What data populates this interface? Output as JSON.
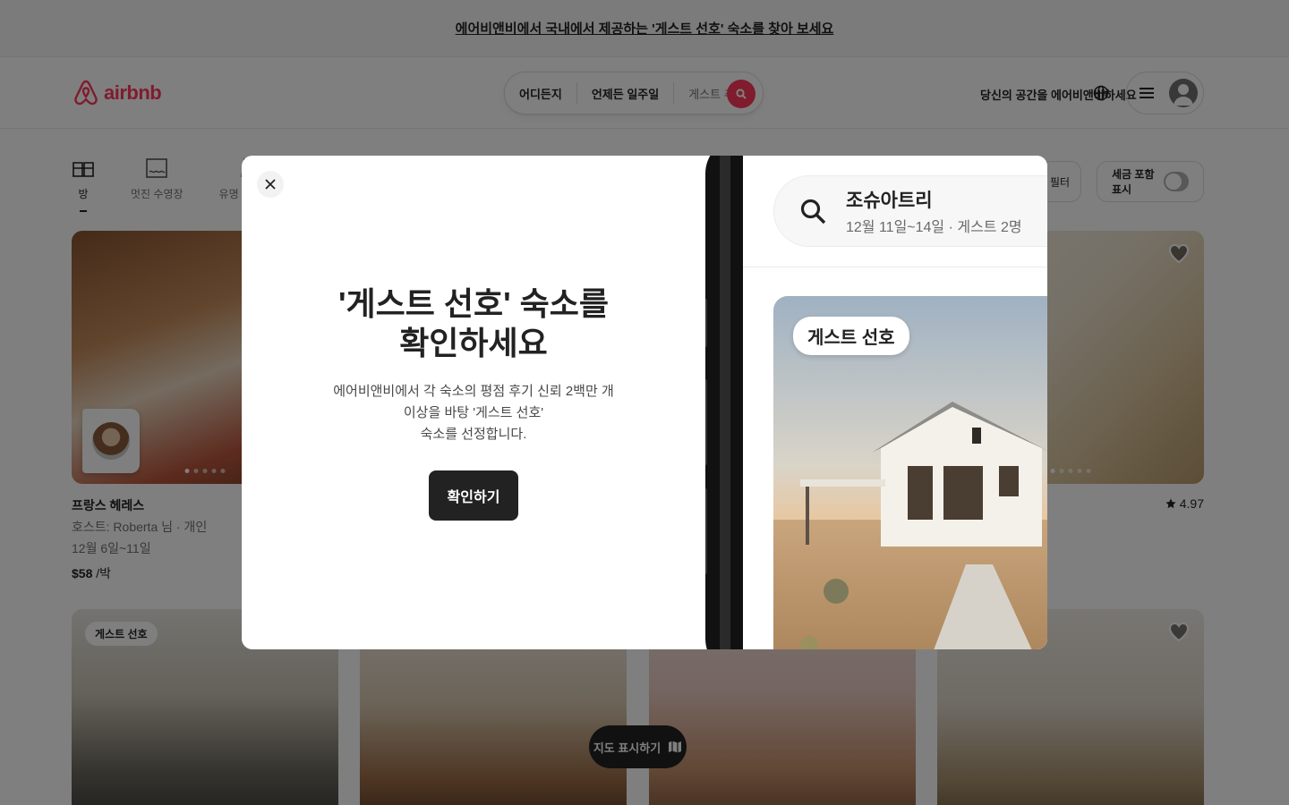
{
  "banner": {
    "text": "에어비앤비에서 국내에서 제공하는 '게스트 선호' 숙소를 찾아 보세요"
  },
  "header": {
    "logo_text": "airbnb",
    "search": {
      "where": "어디든지",
      "when": "언제든 일주일",
      "guests": "게스트 추가"
    },
    "host_link": "당신의 공간을 에어비앤비하세요"
  },
  "categories": [
    {
      "label": "방",
      "icon": "room-icon",
      "active": true
    },
    {
      "label": "멋진 수영장",
      "icon": "pool-icon",
      "active": false
    },
    {
      "label": "유명 관광지",
      "icon": "landmark-icon",
      "active": false
    }
  ],
  "filters": {
    "filter_label": "필터",
    "tax_label": "세금 포함 표시"
  },
  "listings": [
    {
      "title": "프랑스 헤레스",
      "host": "호스트: Roberta 님 · 개인",
      "dates": "12월 6일~11일",
      "price": "$58",
      "per": "/박"
    },
    {
      "rating": "4.97"
    }
  ],
  "listings_row2": [
    {
      "badge": "게스트 선호"
    }
  ],
  "map_button": {
    "label": "지도 표시하기"
  },
  "modal": {
    "title_line1": "'게스트 선호' 숙소를",
    "title_line2": "확인하세요",
    "body_line1": "에어비앤비에서 각 숙소의 평점 후기 신뢰 2백만 개 이상을 바탕 '게스트 선호'",
    "body_line2": "숙소를 선정합니다.",
    "cta": "확인하기",
    "app_search_title": "조슈아트리",
    "app_search_sub": "12월 11일~14일 · 게스트 2명",
    "app_badge": "게스트 선호"
  },
  "colors": {
    "brand": "#ff385c",
    "text": "#222222",
    "muted": "#717171"
  }
}
